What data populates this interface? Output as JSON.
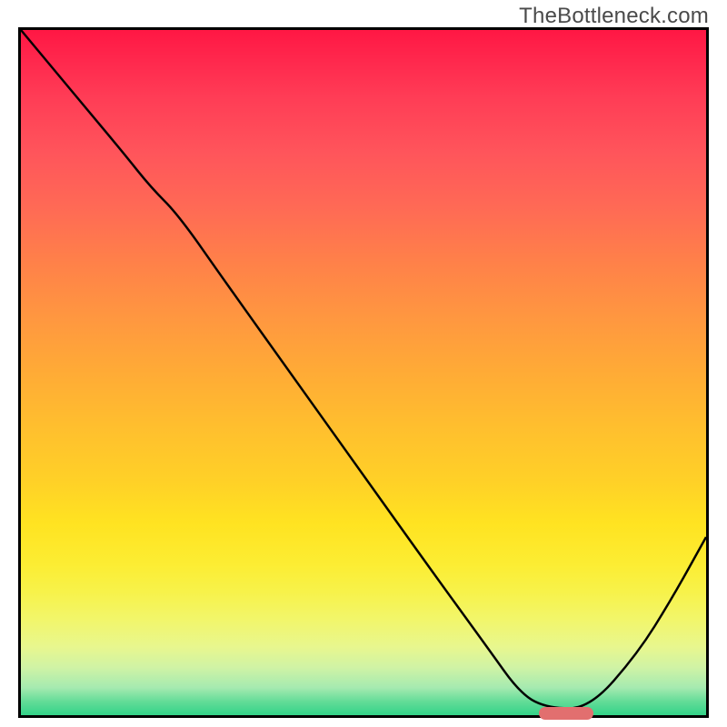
{
  "watermark": "TheBottleneck.com",
  "colors": {
    "curve_stroke": "#000000",
    "frame_border": "#000000",
    "marker_fill": "#e26f6f"
  },
  "chart_data": {
    "type": "line",
    "title": "",
    "xlabel": "",
    "ylabel": "",
    "xlim": [
      0,
      1
    ],
    "ylim": [
      0,
      1
    ],
    "grid": false,
    "legend": false,
    "series": [
      {
        "name": "bottleneck-curve",
        "x": [
          0.0,
          0.05,
          0.1,
          0.15,
          0.19,
          0.23,
          0.3,
          0.4,
          0.5,
          0.6,
          0.68,
          0.73,
          0.77,
          0.83,
          0.9,
          0.95,
          1.0
        ],
        "y": [
          1.0,
          0.94,
          0.88,
          0.82,
          0.77,
          0.73,
          0.63,
          0.49,
          0.35,
          0.21,
          0.1,
          0.03,
          0.01,
          0.01,
          0.09,
          0.17,
          0.26
        ]
      }
    ],
    "annotations": [
      {
        "name": "optimal-marker",
        "x": 0.79,
        "y": 0.01,
        "shape": "pill",
        "color": "#e26f6f"
      }
    ],
    "gradient_stops": [
      {
        "pos": 0.0,
        "color": "#ff1744"
      },
      {
        "pos": 0.5,
        "color": "#ffab36"
      },
      {
        "pos": 0.82,
        "color": "#f7f24a"
      },
      {
        "pos": 1.0,
        "color": "#33d388"
      }
    ]
  }
}
